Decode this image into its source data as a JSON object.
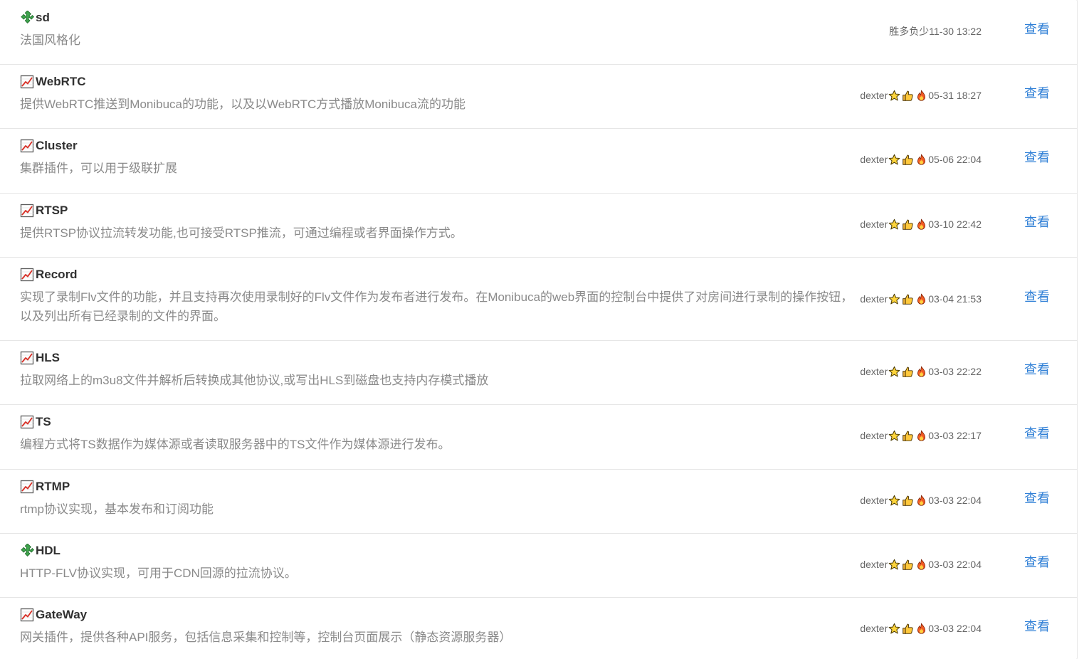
{
  "items": [
    {
      "icon": "puzzle-icon",
      "title": "sd",
      "description": "法国风格化",
      "author": "胜多负少",
      "show_badges": false,
      "date": "11-30 13:22",
      "action": "查看"
    },
    {
      "icon": "chart-increasing-icon",
      "title": "WebRTC",
      "description": "提供WebRTC推送到Monibuca的功能，以及以WebRTC方式播放Monibuca流的功能",
      "author": "dexter",
      "show_badges": true,
      "date": "05-31 18:27",
      "action": "查看"
    },
    {
      "icon": "chart-increasing-icon",
      "title": "Cluster",
      "description": "集群插件，可以用于级联扩展",
      "author": "dexter",
      "show_badges": true,
      "date": "05-06 22:04",
      "action": "查看"
    },
    {
      "icon": "chart-increasing-icon",
      "title": "RTSP",
      "description": "提供RTSP协议拉流转发功能,也可接受RTSP推流，可通过编程或者界面操作方式。",
      "author": "dexter",
      "show_badges": true,
      "date": "03-10 22:42",
      "action": "查看"
    },
    {
      "icon": "chart-increasing-icon",
      "title": "Record",
      "description": "实现了录制Flv文件的功能，并且支持再次使用录制好的Flv文件作为发布者进行发布。在Monibuca的web界面的控制台中提供了对房间进行录制的操作按钮，以及列出所有已经录制的文件的界面。",
      "author": "dexter",
      "show_badges": true,
      "date": "03-04 21:53",
      "action": "查看"
    },
    {
      "icon": "chart-increasing-icon",
      "title": "HLS",
      "description": "拉取网络上的m3u8文件并解析后转换成其他协议,或写出HLS到磁盘也支持内存模式播放",
      "author": "dexter",
      "show_badges": true,
      "date": "03-03 22:22",
      "action": "查看"
    },
    {
      "icon": "chart-increasing-icon",
      "title": "TS",
      "description": "编程方式将TS数据作为媒体源或者读取服务器中的TS文件作为媒体源进行发布。",
      "author": "dexter",
      "show_badges": true,
      "date": "03-03 22:17",
      "action": "查看"
    },
    {
      "icon": "chart-increasing-icon",
      "title": "RTMP",
      "description": "rtmp协议实现，基本发布和订阅功能",
      "author": "dexter",
      "show_badges": true,
      "date": "03-03 22:04",
      "action": "查看"
    },
    {
      "icon": "puzzle-icon",
      "title": "HDL",
      "description": "HTTP-FLV协议实现，可用于CDN回源的拉流协议。",
      "author": "dexter",
      "show_badges": true,
      "date": "03-03 22:04",
      "action": "查看"
    },
    {
      "icon": "chart-increasing-icon",
      "title": "GateWay",
      "description": "网关插件，提供各种API服务，包括信息采集和控制等，控制台页面展示（静态资源服务器）",
      "author": "dexter",
      "show_badges": true,
      "date": "03-03 22:04",
      "action": "查看"
    }
  ],
  "badges": [
    "star-icon",
    "thumbs-up-icon",
    "fire-icon"
  ],
  "colors": {
    "link": "#2f7fd6",
    "title": "#303030",
    "description": "#8a8a8a",
    "meta": "#666666",
    "divider": "#e6e6e6"
  }
}
